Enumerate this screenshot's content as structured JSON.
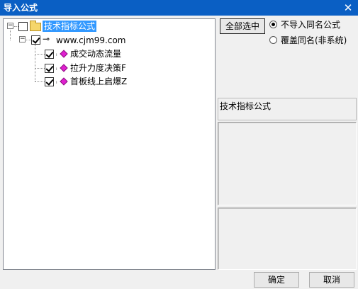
{
  "window": {
    "title": "导入公式",
    "close_glyph": "✕"
  },
  "tree": {
    "root": {
      "label": "技术指标公式",
      "checked": false,
      "expanded": true,
      "selected": true
    },
    "source": {
      "label": "www.cjm99.com",
      "checked": true,
      "expanded": true,
      "icon": "key-icon"
    },
    "formulas": [
      {
        "label": "成交动态流量",
        "checked": true,
        "icon": "gem-icon"
      },
      {
        "label": "拉升力度决策F",
        "checked": true,
        "icon": "gem-icon"
      },
      {
        "label": "首板线上启爆Z",
        "checked": true,
        "icon": "gem-icon"
      }
    ]
  },
  "options": {
    "select_all_label": "全部选中",
    "radio_skip_label": "不导入同名公式",
    "radio_overwrite_label": "覆盖同名(非系统)",
    "selected": "skip"
  },
  "info": {
    "category_label": "技术指标公式"
  },
  "footer": {
    "ok_label": "确定",
    "cancel_label": "取消"
  }
}
